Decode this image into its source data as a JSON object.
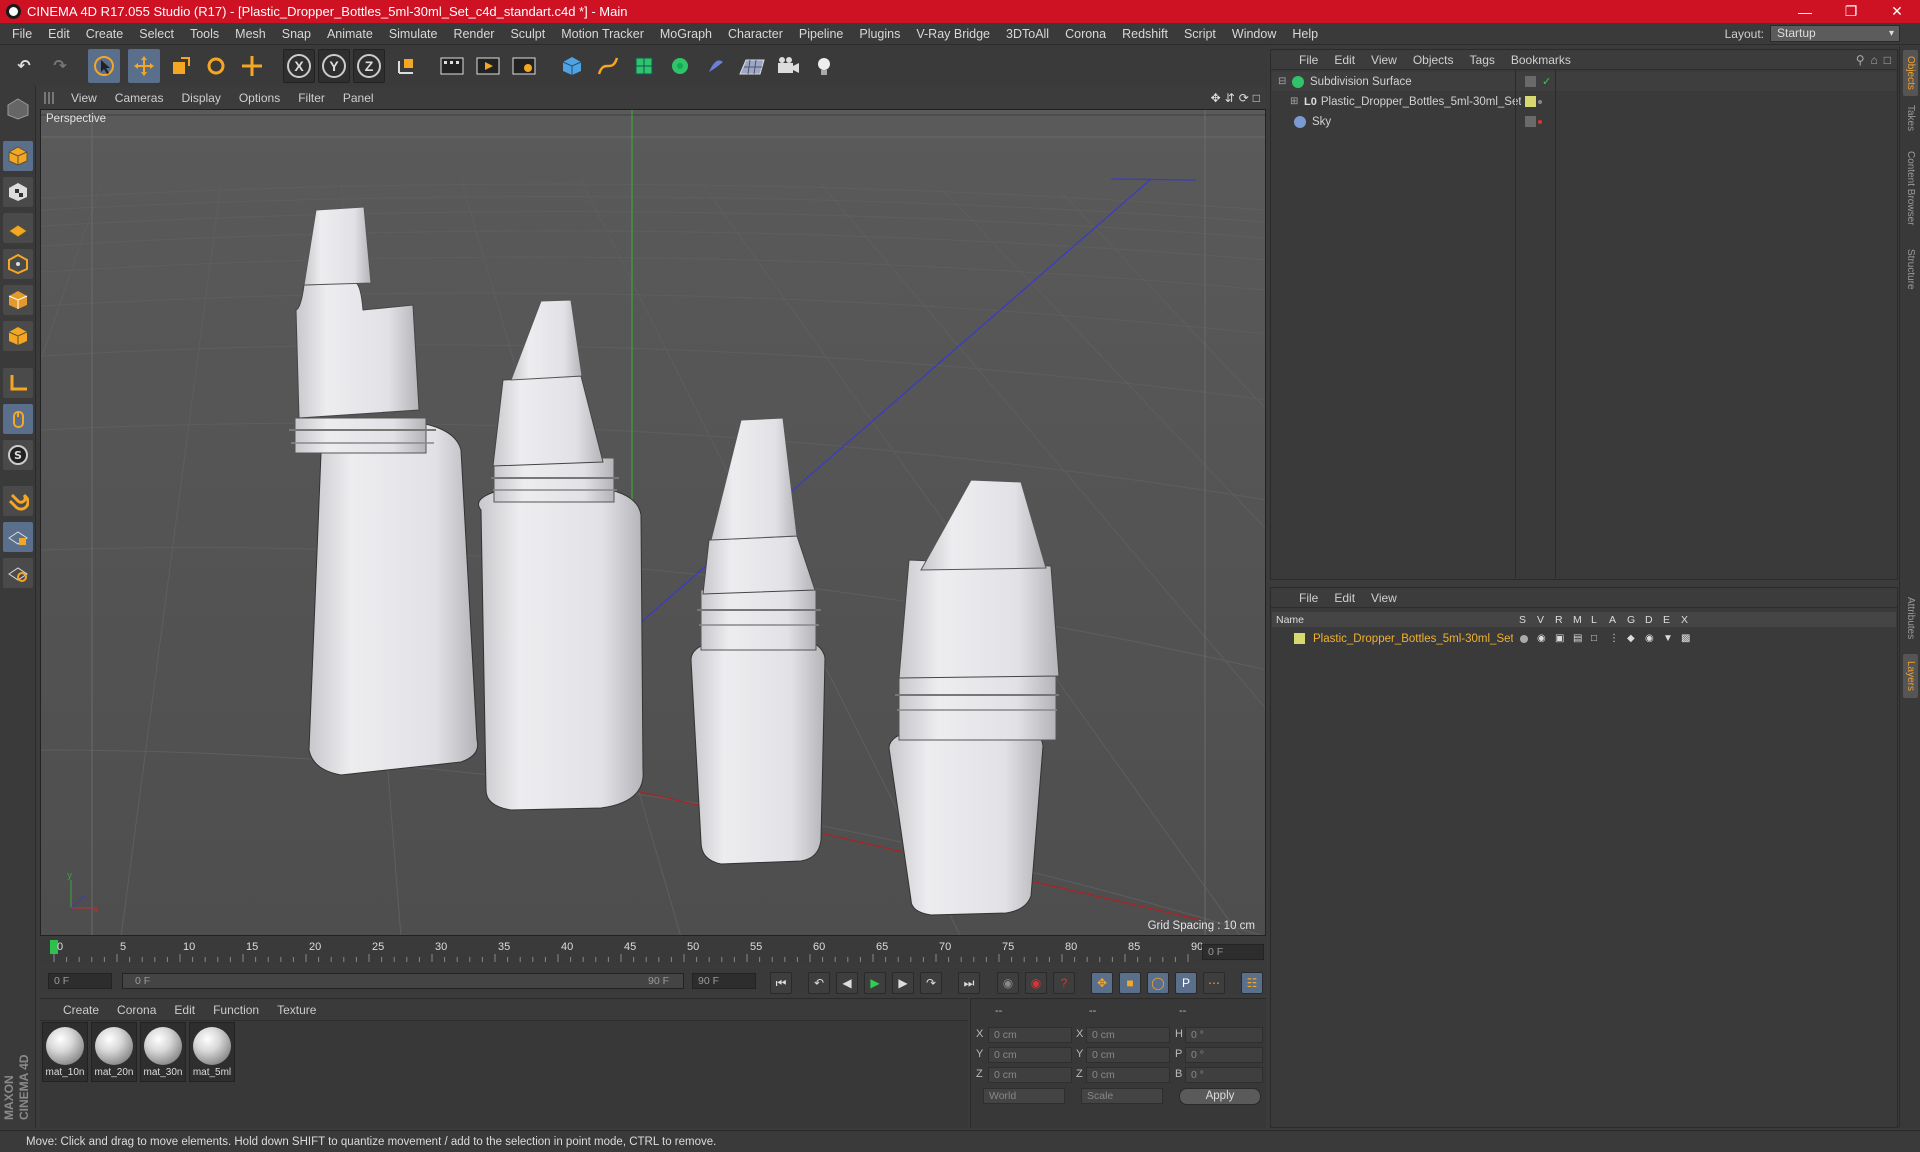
{
  "window": {
    "title": "CINEMA 4D R17.055 Studio (R17) - [Plastic_Dropper_Bottles_5ml-30ml_Set_c4d_standart.c4d *] - Main"
  },
  "menubar": [
    "File",
    "Edit",
    "Create",
    "Select",
    "Tools",
    "Mesh",
    "Snap",
    "Animate",
    "Simulate",
    "Render",
    "Sculpt",
    "Motion Tracker",
    "MoGraph",
    "Character",
    "Pipeline",
    "Plugins",
    "V-Ray Bridge",
    "3DToAll",
    "Corona",
    "Redshift",
    "Script",
    "Window",
    "Help"
  ],
  "layout": {
    "label": "Layout:",
    "value": "Startup"
  },
  "viewport": {
    "menu": [
      "View",
      "Cameras",
      "Display",
      "Options",
      "Filter",
      "Panel"
    ],
    "label": "Perspective",
    "grid_spacing": "Grid Spacing : 10 cm"
  },
  "timeline": {
    "ticks": [
      "0",
      "5",
      "10",
      "15",
      "20",
      "25",
      "30",
      "35",
      "40",
      "45",
      "50",
      "55",
      "60",
      "65",
      "70",
      "75",
      "80",
      "85",
      "90"
    ],
    "current_frame_right": "0 F",
    "start_frame": "0 F",
    "range_start": "0 F",
    "range_end": "90 F",
    "end_frame": "90 F"
  },
  "materials": {
    "menu": [
      "Create",
      "Corona",
      "Edit",
      "Function",
      "Texture"
    ],
    "items": [
      "mat_10n",
      "mat_20n",
      "mat_30n",
      "mat_5ml"
    ]
  },
  "coordinates": {
    "headers": [
      "--",
      "--",
      "--"
    ],
    "rows": [
      {
        "a": "X",
        "av": "0 cm",
        "b": "X",
        "bv": "0 cm",
        "c": "H",
        "cv": "0 °"
      },
      {
        "a": "Y",
        "av": "0 cm",
        "b": "Y",
        "bv": "0 cm",
        "c": "P",
        "cv": "0 °"
      },
      {
        "a": "Z",
        "av": "0 cm",
        "b": "Z",
        "bv": "0 cm",
        "c": "B",
        "cv": "0 °"
      }
    ],
    "mode1": "World",
    "mode2": "Scale",
    "apply": "Apply"
  },
  "objects": {
    "menu": [
      "File",
      "Edit",
      "View",
      "Objects",
      "Tags",
      "Bookmarks"
    ],
    "items": [
      "Subdivision Surface",
      "Plastic_Dropper_Bottles_5ml-30ml_Set",
      "Sky"
    ]
  },
  "layers": {
    "menu": [
      "File",
      "Edit",
      "View"
    ],
    "columns": [
      "Name",
      "S",
      "V",
      "R",
      "M",
      "L",
      "A",
      "G",
      "D",
      "E",
      "X"
    ],
    "items": [
      "Plastic_Dropper_Bottles_5ml-30ml_Set"
    ]
  },
  "side_tabs": [
    "Objects",
    "Takes",
    "Content Browser",
    "Structure",
    "Attributes",
    "Layers"
  ],
  "status": "Move: Click and drag to move elements. Hold down SHIFT to quantize movement / add to the selection in point mode, CTRL to remove.",
  "brand": "MAXON CINEMA 4D",
  "colors": {
    "titlebar": "#cf1124",
    "layer_text": "#f0b030",
    "accent_blue": "#5a6f8c"
  }
}
